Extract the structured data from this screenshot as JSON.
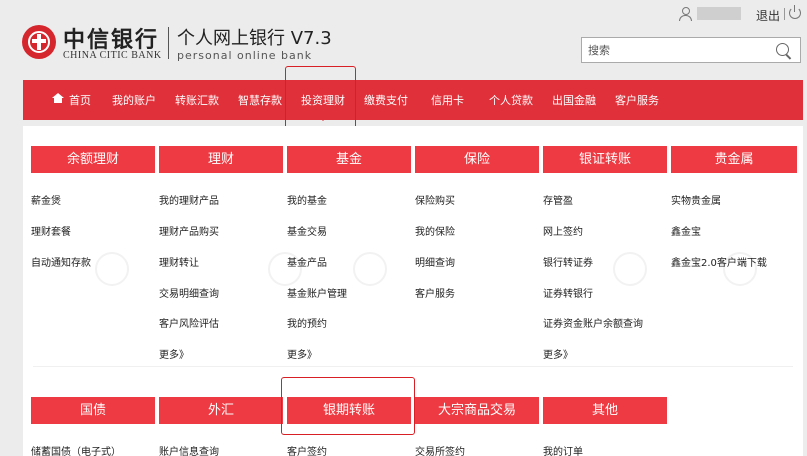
{
  "brand": {
    "name_cn": "中信银行",
    "name_en": "CHINA CITIC BANK",
    "product_cn": "个人网上银行 V7.3",
    "product_en": "personal online bank"
  },
  "top_links": {
    "logout": "退出"
  },
  "search": {
    "placeholder": "搜索"
  },
  "nav": {
    "items": [
      "首页",
      "我的账户",
      "转账汇款",
      "智慧存款",
      "投资理财",
      "缴费支付",
      "信用卡",
      "个人贷款",
      "出国金融",
      "客户服务"
    ],
    "active": "投资理财"
  },
  "colors": {
    "brand_red": "#e0303a",
    "header_red": "#ee3a42",
    "highlight": "#d81f26"
  },
  "menu_row1": [
    {
      "title": "余额理财",
      "links": [
        "薪金煲",
        "理财套餐",
        "自动通知存款"
      ]
    },
    {
      "title": "理财",
      "links": [
        "我的理财产品",
        "理财产品购买",
        "理财转让",
        "交易明细查询",
        "客户风险评估",
        "更多》"
      ]
    },
    {
      "title": "基金",
      "links": [
        "我的基金",
        "基金交易",
        "基金产品",
        "基金账户管理",
        "我的预约",
        "更多》"
      ]
    },
    {
      "title": "保险",
      "links": [
        "保险购买",
        "我的保险",
        "明细查询",
        "客户服务"
      ]
    },
    {
      "title": "银证转账",
      "links": [
        "存管盈",
        "网上签约",
        "银行转证券",
        "证券转银行",
        "证券资金账户余额查询",
        "更多》"
      ]
    },
    {
      "title": "贵金属",
      "links": [
        "实物贵金属",
        "鑫金宝",
        "鑫金宝2.0客户端下载"
      ]
    }
  ],
  "menu_row2": [
    {
      "title": "国债",
      "links": [
        "储蓄国债（电子式）"
      ]
    },
    {
      "title": "外汇",
      "links": [
        "账户信息查询"
      ]
    },
    {
      "title": "银期转账",
      "links": [
        "客户签约"
      ]
    },
    {
      "title": "大宗商品交易",
      "links": [
        "交易所签约"
      ]
    },
    {
      "title": "其他",
      "links": [
        "我的订单"
      ]
    }
  ]
}
